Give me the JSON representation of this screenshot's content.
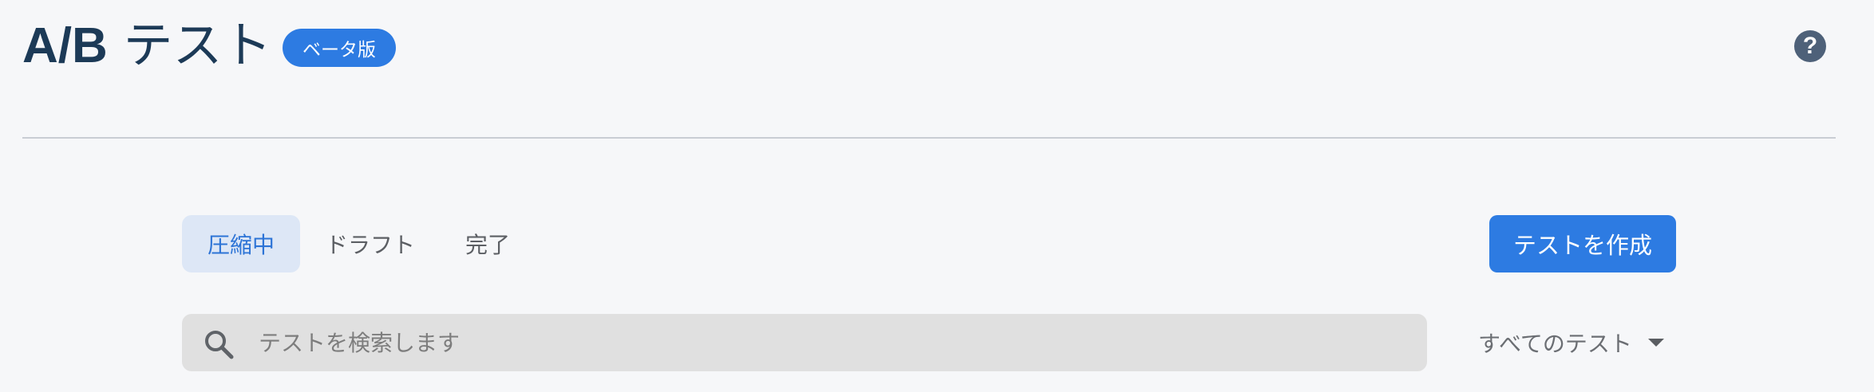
{
  "header": {
    "title_latin": "A/B",
    "title_kana": " テスト",
    "badge": "ベータ版",
    "help_symbol": "?"
  },
  "tabs": [
    {
      "label": "圧縮中",
      "active": true
    },
    {
      "label": "ドラフト",
      "active": false
    },
    {
      "label": "完了",
      "active": false
    }
  ],
  "actions": {
    "create_label": "テストを作成"
  },
  "search": {
    "placeholder": "テストを検索します",
    "value": ""
  },
  "filter": {
    "selected": "すべてのテスト"
  },
  "colors": {
    "accent": "#2d7be2",
    "title": "#1c3a57",
    "background": "#f6f7f9",
    "active_tab_bg": "#dde7f6"
  },
  "icons": {
    "help": "help-circle-icon",
    "search": "search-icon",
    "dropdown": "caret-down-icon"
  }
}
